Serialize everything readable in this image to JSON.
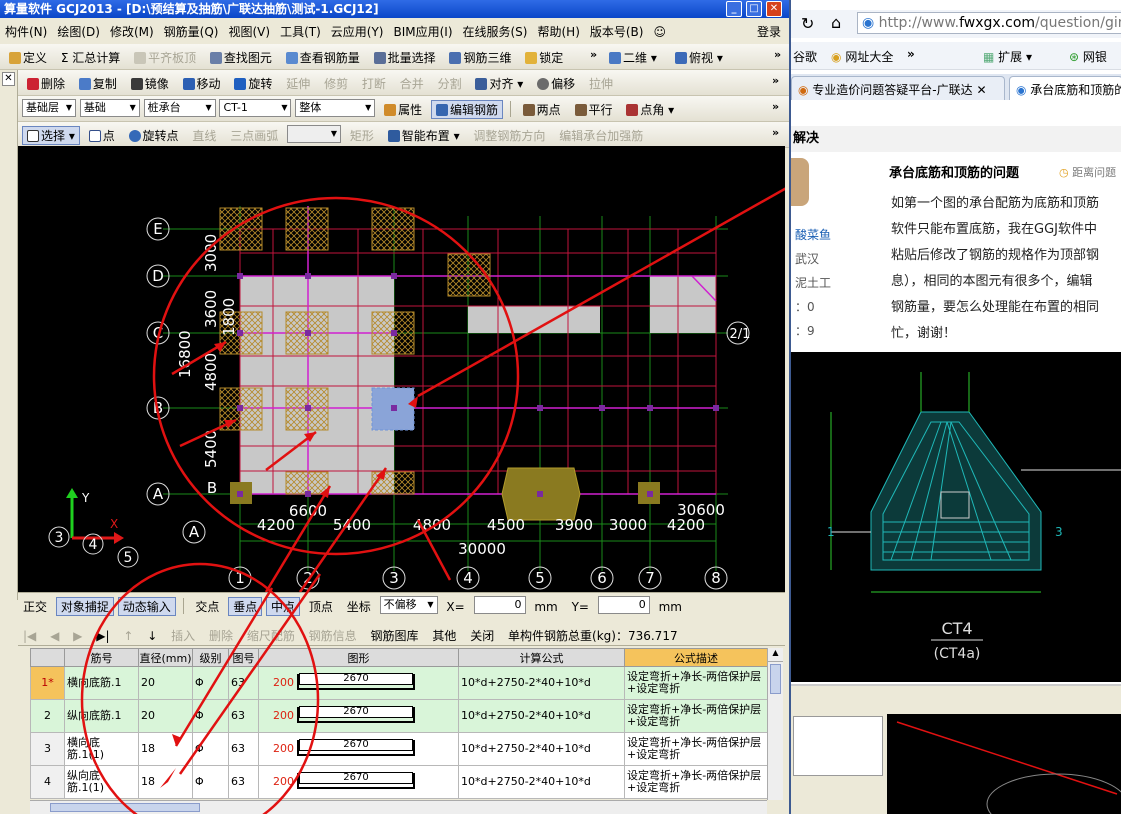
{
  "window": {
    "title": "算量软件 GCJ2013 - [D:\\预结算及抽筋\\广联达抽筋\\测试-1.GCJ12]",
    "min": "_",
    "max": "□",
    "close": "✕"
  },
  "menu": {
    "items": [
      "构件(N)",
      "绘图(D)",
      "修改(M)",
      "钢筋量(Q)",
      "视图(V)",
      "工具(T)",
      "云应用(Y)",
      "BIM应用(I)",
      "在线服务(S)",
      "帮助(H)",
      "版本号(B)"
    ],
    "login": "登录"
  },
  "toolbar1": {
    "items": [
      "定义",
      "Σ 汇总计算",
      "平齐板顶",
      "查找图元",
      "查看钢筋量",
      "批量选择",
      "钢筋三维",
      "锁定"
    ],
    "view2d": "二维",
    "viewmode": "俯视"
  },
  "toolbar2": {
    "items": [
      "删除",
      "复制",
      "镜像",
      "移动",
      "旋转",
      "延伸",
      "修剪",
      "打断",
      "合并",
      "分割",
      "对齐",
      "偏移",
      "拉伸"
    ]
  },
  "toolbar3": {
    "layer": "基础层",
    "category": "基础",
    "type": "桩承台",
    "element": "CT-1",
    "part": "整体",
    "attr": "属性",
    "edit_rebar": "编辑钢筋",
    "two_points": "两点",
    "parallel": "平行",
    "point_angle": "点角"
  },
  "toolbar4": {
    "items": [
      "选择",
      "点",
      "旋转点",
      "直线",
      "三点画弧",
      "矩形",
      "智能布置",
      "调整钢筋方向",
      "编辑承台加强筋"
    ]
  },
  "canvas": {
    "axis_rows": [
      "E",
      "D",
      "C",
      "B",
      "A"
    ],
    "axis_cols": [
      "1",
      "2",
      "3",
      "4",
      "5",
      "6",
      "7",
      "8"
    ],
    "left_dims": [
      "3000",
      "3600",
      "1800",
      "4800",
      "5400",
      "16800"
    ],
    "bottom_dims": [
      "4200",
      "6600",
      "5400",
      "4800",
      "4500",
      "3900",
      "3000",
      "4200"
    ],
    "total_dim": "30000",
    "label_2_1": "2/1",
    "label_30600": "30600",
    "label_A": "A",
    "label_B": "B",
    "coord_y": "Y",
    "coord_x": "X",
    "coord_nums": [
      "3",
      "4",
      "5"
    ]
  },
  "statusbar": {
    "items": [
      "正交",
      "对象捕捉",
      "动态输入",
      "交点",
      "垂点",
      "中点",
      "顶点",
      "坐标"
    ],
    "offset": "不偏移",
    "x_label": "X=",
    "x_val": "0",
    "y_label": "Y=",
    "y_val": "0",
    "unit": "mm"
  },
  "grid_toolbar": {
    "items": [
      "插入",
      "删除",
      "缩尺配筋",
      "钢筋信息",
      "钢筋图库",
      "其他",
      "关闭"
    ],
    "total_label": "单构件钢筋总重(kg)：736.717"
  },
  "table": {
    "headers": [
      "筋号",
      "直径(mm)",
      "级别",
      "图号",
      "图形",
      "计算公式",
      "公式描述"
    ],
    "rows": [
      {
        "no": "1*",
        "name": "横向底筋.1",
        "dia": "20",
        "grade": "Φ",
        "fig": "63",
        "shape_num": "200",
        "shape_len": "2670",
        "formula": "10*d+2750-2*40+10*d",
        "desc": "设定弯折+净长-两倍保护层+设定弯折"
      },
      {
        "no": "2",
        "name": "纵向底筋.1",
        "dia": "20",
        "grade": "Φ",
        "fig": "63",
        "shape_num": "200",
        "shape_len": "2670",
        "formula": "10*d+2750-2*40+10*d",
        "desc": "设定弯折+净长-两倍保护层+设定弯折"
      },
      {
        "no": "3",
        "name": "横向底筋.1(1)",
        "dia": "18",
        "grade": "Φ",
        "fig": "63",
        "shape_num": "200",
        "shape_len": "2670",
        "formula": "10*d+2750-2*40+10*d",
        "desc": "设定弯折+净长-两倍保护层+设定弯折"
      },
      {
        "no": "4",
        "name": "纵向底筋.1(1)",
        "dia": "18",
        "grade": "Φ",
        "fig": "63",
        "shape_num": "200",
        "shape_len": "2670",
        "formula": "10*d+2750-2*40+10*d",
        "desc": "设定弯折+净长-两倍保护层+设定弯折"
      }
    ]
  },
  "browser": {
    "url_prefix": "http://www.",
    "url_domain": "fwxgx.com",
    "url_rest": "/question/gim",
    "bookmarks": [
      "谷歌",
      "网址大全",
      "扩展",
      "网银"
    ],
    "tabs": [
      "专业造价问题答疑平台-广联达",
      "承台底筋和顶筋的"
    ],
    "solution_label": "解决",
    "question_title": "承台底筋和顶筋的问题",
    "distance_label": "距离问题",
    "question_lines": [
      "如第一个图的承台配筋为底筋和顶筋",
      "软件只能布置底筋，我在GGJ软件中",
      "粘贴后修改了钢筋的规格作为顶部钢",
      "息），相同的本图元有很多个，编辑",
      "钢筋量，要怎么处理能在布置的相同",
      "忙，谢谢！"
    ],
    "user_name": "酸菜鱼",
    "user_city": "武汉",
    "user_major": "泥土工",
    "user_stat1": "：0",
    "user_stat2": "：9",
    "drawing_title": "CT4",
    "drawing_subtitle": "(CT4a)",
    "drawing_label_left": "1",
    "drawing_label_right": "3"
  },
  "colors": {
    "accent": "#f5c35c",
    "annotation": "#e11111",
    "canvas_bg": "#000000",
    "grid_red": "#c0143c",
    "grid_green": "#1a8a1a",
    "slab": "#c8c8c8"
  }
}
